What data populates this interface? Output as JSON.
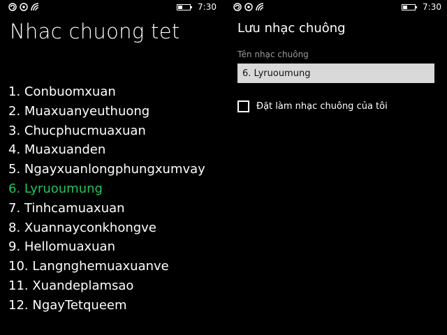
{
  "status_bar": {
    "time": "7:30",
    "battery_level": 0.4
  },
  "ringtone_list": {
    "title": "Nhac chuong tet",
    "selected_index": 5,
    "items": [
      "1. Conbuomxuan",
      "2. Muaxuanyeuthuong",
      "3. Chucphucmuaxuan",
      "4. Muaxuanden",
      "5. Ngayxuanlongphungxumvay",
      "6. Lyruoumung",
      "7. Tinhcamuaxuan",
      "8. Xuannayconkhongve",
      "9. Hellomuaxuan",
      "10. Langnghemuaxuanve",
      "11. Xuandeplamsao",
      "12. NgayTetqueem"
    ]
  },
  "save_ringtone": {
    "title": "Lưu nhạc chuông",
    "name_label": "Tên nhạc chuông",
    "name_value": "6. Lyruoumung",
    "set_as_ringtone_label": "Đặt làm nhạc chuông của tôi",
    "set_as_ringtone_checked": false
  },
  "colors": {
    "background": "#000000",
    "accent_selected": "#22c55e",
    "input_bg": "#d9d9d9"
  }
}
